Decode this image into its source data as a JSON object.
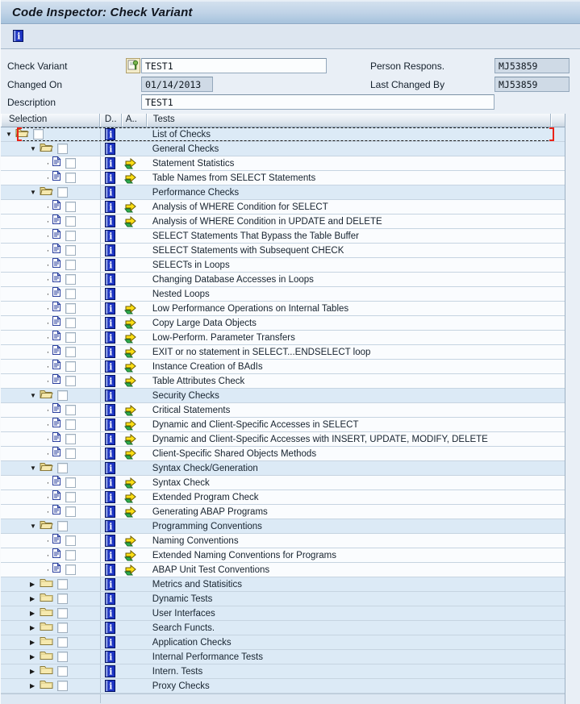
{
  "title": "Code Inspector: Check Variant",
  "toolbar": {
    "info_button": "info-icon"
  },
  "form": {
    "check_variant": {
      "label": "Check Variant",
      "value": "TEST1",
      "editable": true,
      "icon": "display-change-icon"
    },
    "person_respons": {
      "label": "Person Respons.",
      "value": "MJ53859",
      "editable": false
    },
    "changed_on": {
      "label": "Changed On",
      "value": "01/14/2013",
      "editable": false
    },
    "last_changed_by": {
      "label": "Last Changed By",
      "value": "MJ53859",
      "editable": false
    },
    "description": {
      "label": "Description",
      "value": "TEST1",
      "editable": true
    }
  },
  "icons": {
    "expanded": "▼",
    "collapsed": "▶",
    "bullet": "·"
  },
  "colors": {
    "info_blue": "#1d34c2",
    "arrow_yellow": "#ffe014",
    "arrow_green": "#2fae4e",
    "folder_yellow": "#f6e9ae",
    "focus_red": "#ea2318",
    "folder_row_bg": "#dceaf6",
    "leaf_row_bg": "#fafcfe"
  },
  "tree": {
    "columns": [
      "Selection",
      "D..",
      "A..",
      "Tests"
    ],
    "rows": [
      {
        "level": 0,
        "icon": "folder-open",
        "expander": "expanded",
        "arrow": false,
        "label": "List of Checks",
        "focused": true
      },
      {
        "level": 1,
        "icon": "folder-open",
        "expander": "expanded",
        "arrow": false,
        "label": "General Checks"
      },
      {
        "level": 2,
        "icon": "document",
        "expander": "leaf",
        "arrow": true,
        "label": "Statement Statistics"
      },
      {
        "level": 2,
        "icon": "document",
        "expander": "leaf",
        "arrow": true,
        "label": "Table Names from SELECT Statements"
      },
      {
        "level": 1,
        "icon": "folder-open",
        "expander": "expanded",
        "arrow": false,
        "label": "Performance Checks"
      },
      {
        "level": 2,
        "icon": "document",
        "expander": "leaf",
        "arrow": true,
        "label": "Analysis of WHERE Condition for SELECT"
      },
      {
        "level": 2,
        "icon": "document",
        "expander": "leaf",
        "arrow": true,
        "label": "Analysis of WHERE Condition in UPDATE and DELETE"
      },
      {
        "level": 2,
        "icon": "document",
        "expander": "leaf",
        "arrow": false,
        "label": "SELECT Statements That Bypass the Table Buffer"
      },
      {
        "level": 2,
        "icon": "document",
        "expander": "leaf",
        "arrow": false,
        "label": "SELECT Statements with Subsequent CHECK"
      },
      {
        "level": 2,
        "icon": "document",
        "expander": "leaf",
        "arrow": false,
        "label": "SELECTs in Loops"
      },
      {
        "level": 2,
        "icon": "document",
        "expander": "leaf",
        "arrow": false,
        "label": "Changing Database Accesses in Loops"
      },
      {
        "level": 2,
        "icon": "document",
        "expander": "leaf",
        "arrow": false,
        "label": "Nested Loops"
      },
      {
        "level": 2,
        "icon": "document",
        "expander": "leaf",
        "arrow": true,
        "label": "Low Performance Operations on Internal Tables"
      },
      {
        "level": 2,
        "icon": "document",
        "expander": "leaf",
        "arrow": true,
        "label": "Copy Large Data Objects"
      },
      {
        "level": 2,
        "icon": "document",
        "expander": "leaf",
        "arrow": true,
        "label": "Low-Perform. Parameter Transfers"
      },
      {
        "level": 2,
        "icon": "document",
        "expander": "leaf",
        "arrow": true,
        "label": "EXIT or no statement in SELECT...ENDSELECT loop"
      },
      {
        "level": 2,
        "icon": "document",
        "expander": "leaf",
        "arrow": true,
        "label": "Instance Creation of BAdIs"
      },
      {
        "level": 2,
        "icon": "document",
        "expander": "leaf",
        "arrow": true,
        "label": "Table Attributes Check"
      },
      {
        "level": 1,
        "icon": "folder-open",
        "expander": "expanded",
        "arrow": false,
        "label": "Security Checks"
      },
      {
        "level": 2,
        "icon": "document",
        "expander": "leaf",
        "arrow": true,
        "label": "Critical Statements"
      },
      {
        "level": 2,
        "icon": "document",
        "expander": "leaf",
        "arrow": true,
        "label": "Dynamic and Client-Specific Accesses in SELECT"
      },
      {
        "level": 2,
        "icon": "document",
        "expander": "leaf",
        "arrow": true,
        "label": "Dynamic and Client-Specific Accesses with INSERT, UPDATE, MODIFY, DELETE"
      },
      {
        "level": 2,
        "icon": "document",
        "expander": "leaf",
        "arrow": true,
        "label": "Client-Specific Shared Objects Methods"
      },
      {
        "level": 1,
        "icon": "folder-open",
        "expander": "expanded",
        "arrow": false,
        "label": "Syntax Check/Generation"
      },
      {
        "level": 2,
        "icon": "document",
        "expander": "leaf",
        "arrow": true,
        "label": "Syntax Check"
      },
      {
        "level": 2,
        "icon": "document",
        "expander": "leaf",
        "arrow": true,
        "label": "Extended Program Check"
      },
      {
        "level": 2,
        "icon": "document",
        "expander": "leaf",
        "arrow": true,
        "label": "Generating ABAP Programs"
      },
      {
        "level": 1,
        "icon": "folder-open",
        "expander": "expanded",
        "arrow": false,
        "label": "Programming Conventions"
      },
      {
        "level": 2,
        "icon": "document",
        "expander": "leaf",
        "arrow": true,
        "label": "Naming Conventions"
      },
      {
        "level": 2,
        "icon": "document",
        "expander": "leaf",
        "arrow": true,
        "label": "Extended Naming Conventions for Programs"
      },
      {
        "level": 2,
        "icon": "document",
        "expander": "leaf",
        "arrow": true,
        "label": "ABAP Unit Test Conventions"
      },
      {
        "level": 1,
        "icon": "folder-closed",
        "expander": "collapsed",
        "arrow": false,
        "label": "Metrics and Statisitics"
      },
      {
        "level": 1,
        "icon": "folder-closed",
        "expander": "collapsed",
        "arrow": false,
        "label": "Dynamic Tests"
      },
      {
        "level": 1,
        "icon": "folder-closed",
        "expander": "collapsed",
        "arrow": false,
        "label": "User Interfaces"
      },
      {
        "level": 1,
        "icon": "folder-closed",
        "expander": "collapsed",
        "arrow": false,
        "label": "Search Functs."
      },
      {
        "level": 1,
        "icon": "folder-closed",
        "expander": "collapsed",
        "arrow": false,
        "label": "Application Checks"
      },
      {
        "level": 1,
        "icon": "folder-closed",
        "expander": "collapsed",
        "arrow": false,
        "label": "Internal Performance Tests"
      },
      {
        "level": 1,
        "icon": "folder-closed",
        "expander": "collapsed",
        "arrow": false,
        "label": "Intern. Tests"
      },
      {
        "level": 1,
        "icon": "folder-closed",
        "expander": "collapsed",
        "arrow": false,
        "label": "Proxy Checks"
      }
    ]
  }
}
